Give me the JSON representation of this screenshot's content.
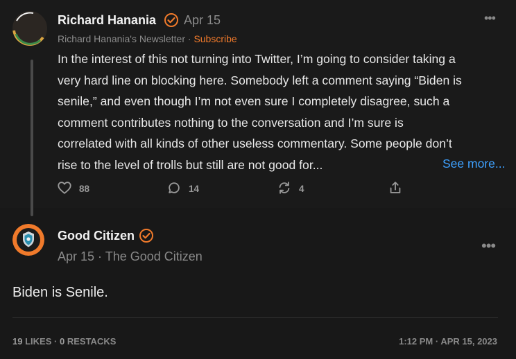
{
  "comment": {
    "author": "Richard Hanania",
    "date": "Apr 15",
    "newsletter": "Richard Hanania's Newsletter",
    "separator": "·",
    "subscribe_label": "Subscribe",
    "more_icon": "ellipsis-icon",
    "body_lines": [
      "In the interest of this not turning into Twitter, I’m going to consider taking a",
      "very hard line on blocking here. Somebody left a comment saying “Biden is",
      "senile,” and even though I’m not even sure I completely disagree, such a",
      "comment contributes nothing to the conversation and I’m sure is",
      "correlated with all kinds of other useless commentary. Some people don’t",
      "rise to the level of trolls but still are not good for..."
    ],
    "see_more_label": "See more...",
    "likes": "88",
    "replies": "14",
    "restacks": "4"
  },
  "reply": {
    "author": "Good Citizen",
    "meta": "Apr 15 · The Good Citizen",
    "more_icon": "ellipsis-icon",
    "body": "Biden is Senile.",
    "likes_count": "19",
    "likes_label": "LIKES",
    "stats_separator": "·",
    "restacks_count": "0",
    "restacks_label": "RESTACKS",
    "timestamp": "1:12 PM · APR 15, 2023"
  },
  "colors": {
    "background": "#181818",
    "accent_orange": "#f07a2b",
    "link_blue": "#3ea1ff",
    "muted_text": "#8a8a8a"
  }
}
